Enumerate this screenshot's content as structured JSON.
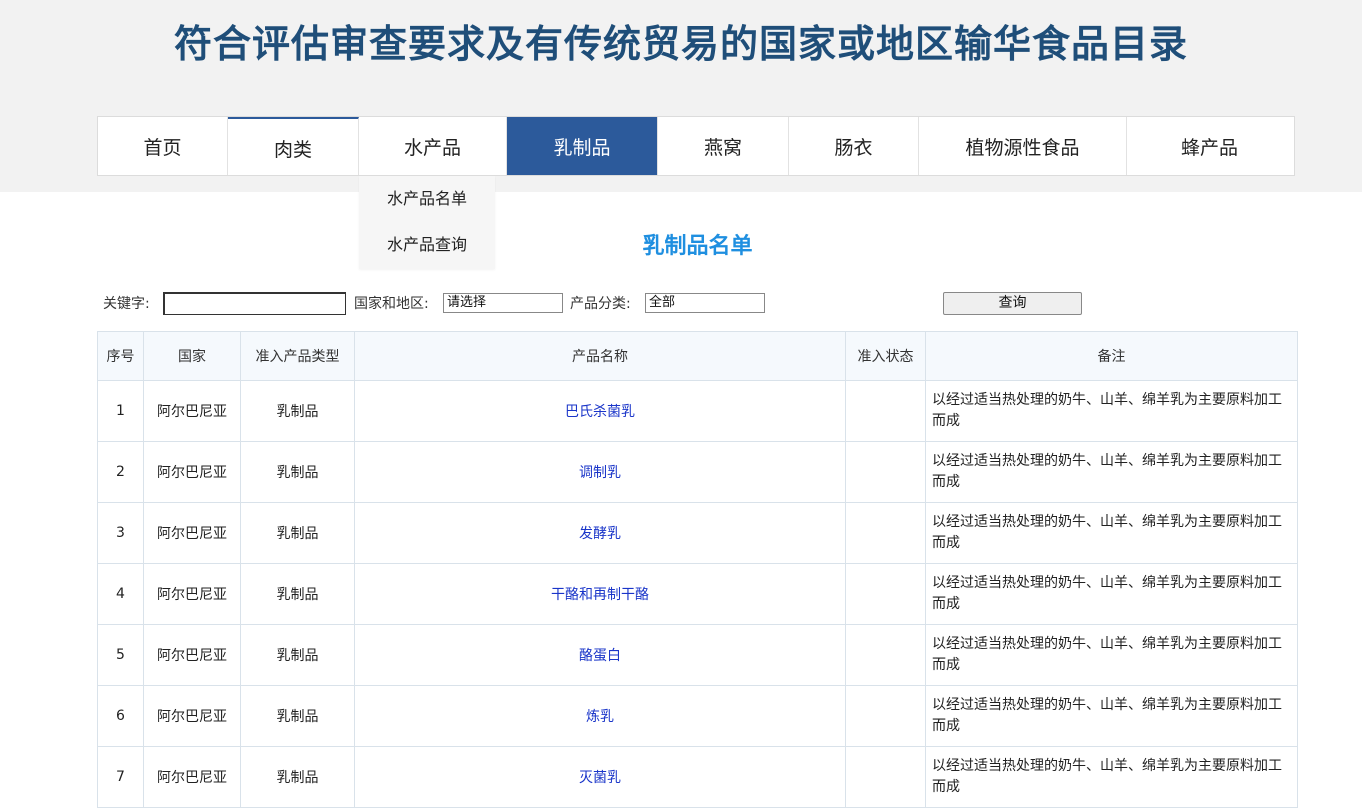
{
  "site": {
    "title": "符合评估审查要求及有传统贸易的国家或地区输华食品目录"
  },
  "nav": {
    "items": [
      {
        "label": "首页"
      },
      {
        "label": "肉类"
      },
      {
        "label": "水产品"
      },
      {
        "label": "乳制品"
      },
      {
        "label": "燕窝"
      },
      {
        "label": "肠衣"
      },
      {
        "label": "植物源性食品"
      },
      {
        "label": "蜂产品"
      }
    ],
    "active": "乳制品",
    "dropdown": {
      "items": [
        {
          "label": "水产品名单"
        },
        {
          "label": "水产品查询"
        }
      ]
    }
  },
  "page": {
    "heading": "乳制品名单"
  },
  "search": {
    "keyword_label": "关键字:",
    "keyword_value": "",
    "region_label": "国家和地区:",
    "region_value": "请选择",
    "category_label": "产品分类:",
    "category_value": "全部",
    "button_label": "查询"
  },
  "table": {
    "headers": [
      "序号",
      "国家",
      "准入产品类型",
      "产品名称",
      "准入状态",
      "备注"
    ],
    "rows": [
      {
        "no": "1",
        "country": "阿尔巴尼亚",
        "type": "乳制品",
        "name": "巴氏杀菌乳",
        "status": "",
        "note": "以经过适当热处理的奶牛、山羊、绵羊乳为主要原料加工而成"
      },
      {
        "no": "2",
        "country": "阿尔巴尼亚",
        "type": "乳制品",
        "name": "调制乳",
        "status": "",
        "note": "以经过适当热处理的奶牛、山羊、绵羊乳为主要原料加工而成"
      },
      {
        "no": "3",
        "country": "阿尔巴尼亚",
        "type": "乳制品",
        "name": "发酵乳",
        "status": "",
        "note": "以经过适当热处理的奶牛、山羊、绵羊乳为主要原料加工而成"
      },
      {
        "no": "4",
        "country": "阿尔巴尼亚",
        "type": "乳制品",
        "name": "干酪和再制干酪",
        "status": "",
        "note": "以经过适当热处理的奶牛、山羊、绵羊乳为主要原料加工而成"
      },
      {
        "no": "5",
        "country": "阿尔巴尼亚",
        "type": "乳制品",
        "name": "酪蛋白",
        "status": "",
        "note": "以经过适当热处理的奶牛、山羊、绵羊乳为主要原料加工而成"
      },
      {
        "no": "6",
        "country": "阿尔巴尼亚",
        "type": "乳制品",
        "name": "炼乳",
        "status": "",
        "note": "以经过适当热处理的奶牛、山羊、绵羊乳为主要原料加工而成"
      },
      {
        "no": "7",
        "country": "阿尔巴尼亚",
        "type": "乳制品",
        "name": "灭菌乳",
        "status": "",
        "note": "以经过适当热处理的奶牛、山羊、绵羊乳为主要原料加工而成"
      }
    ]
  }
}
